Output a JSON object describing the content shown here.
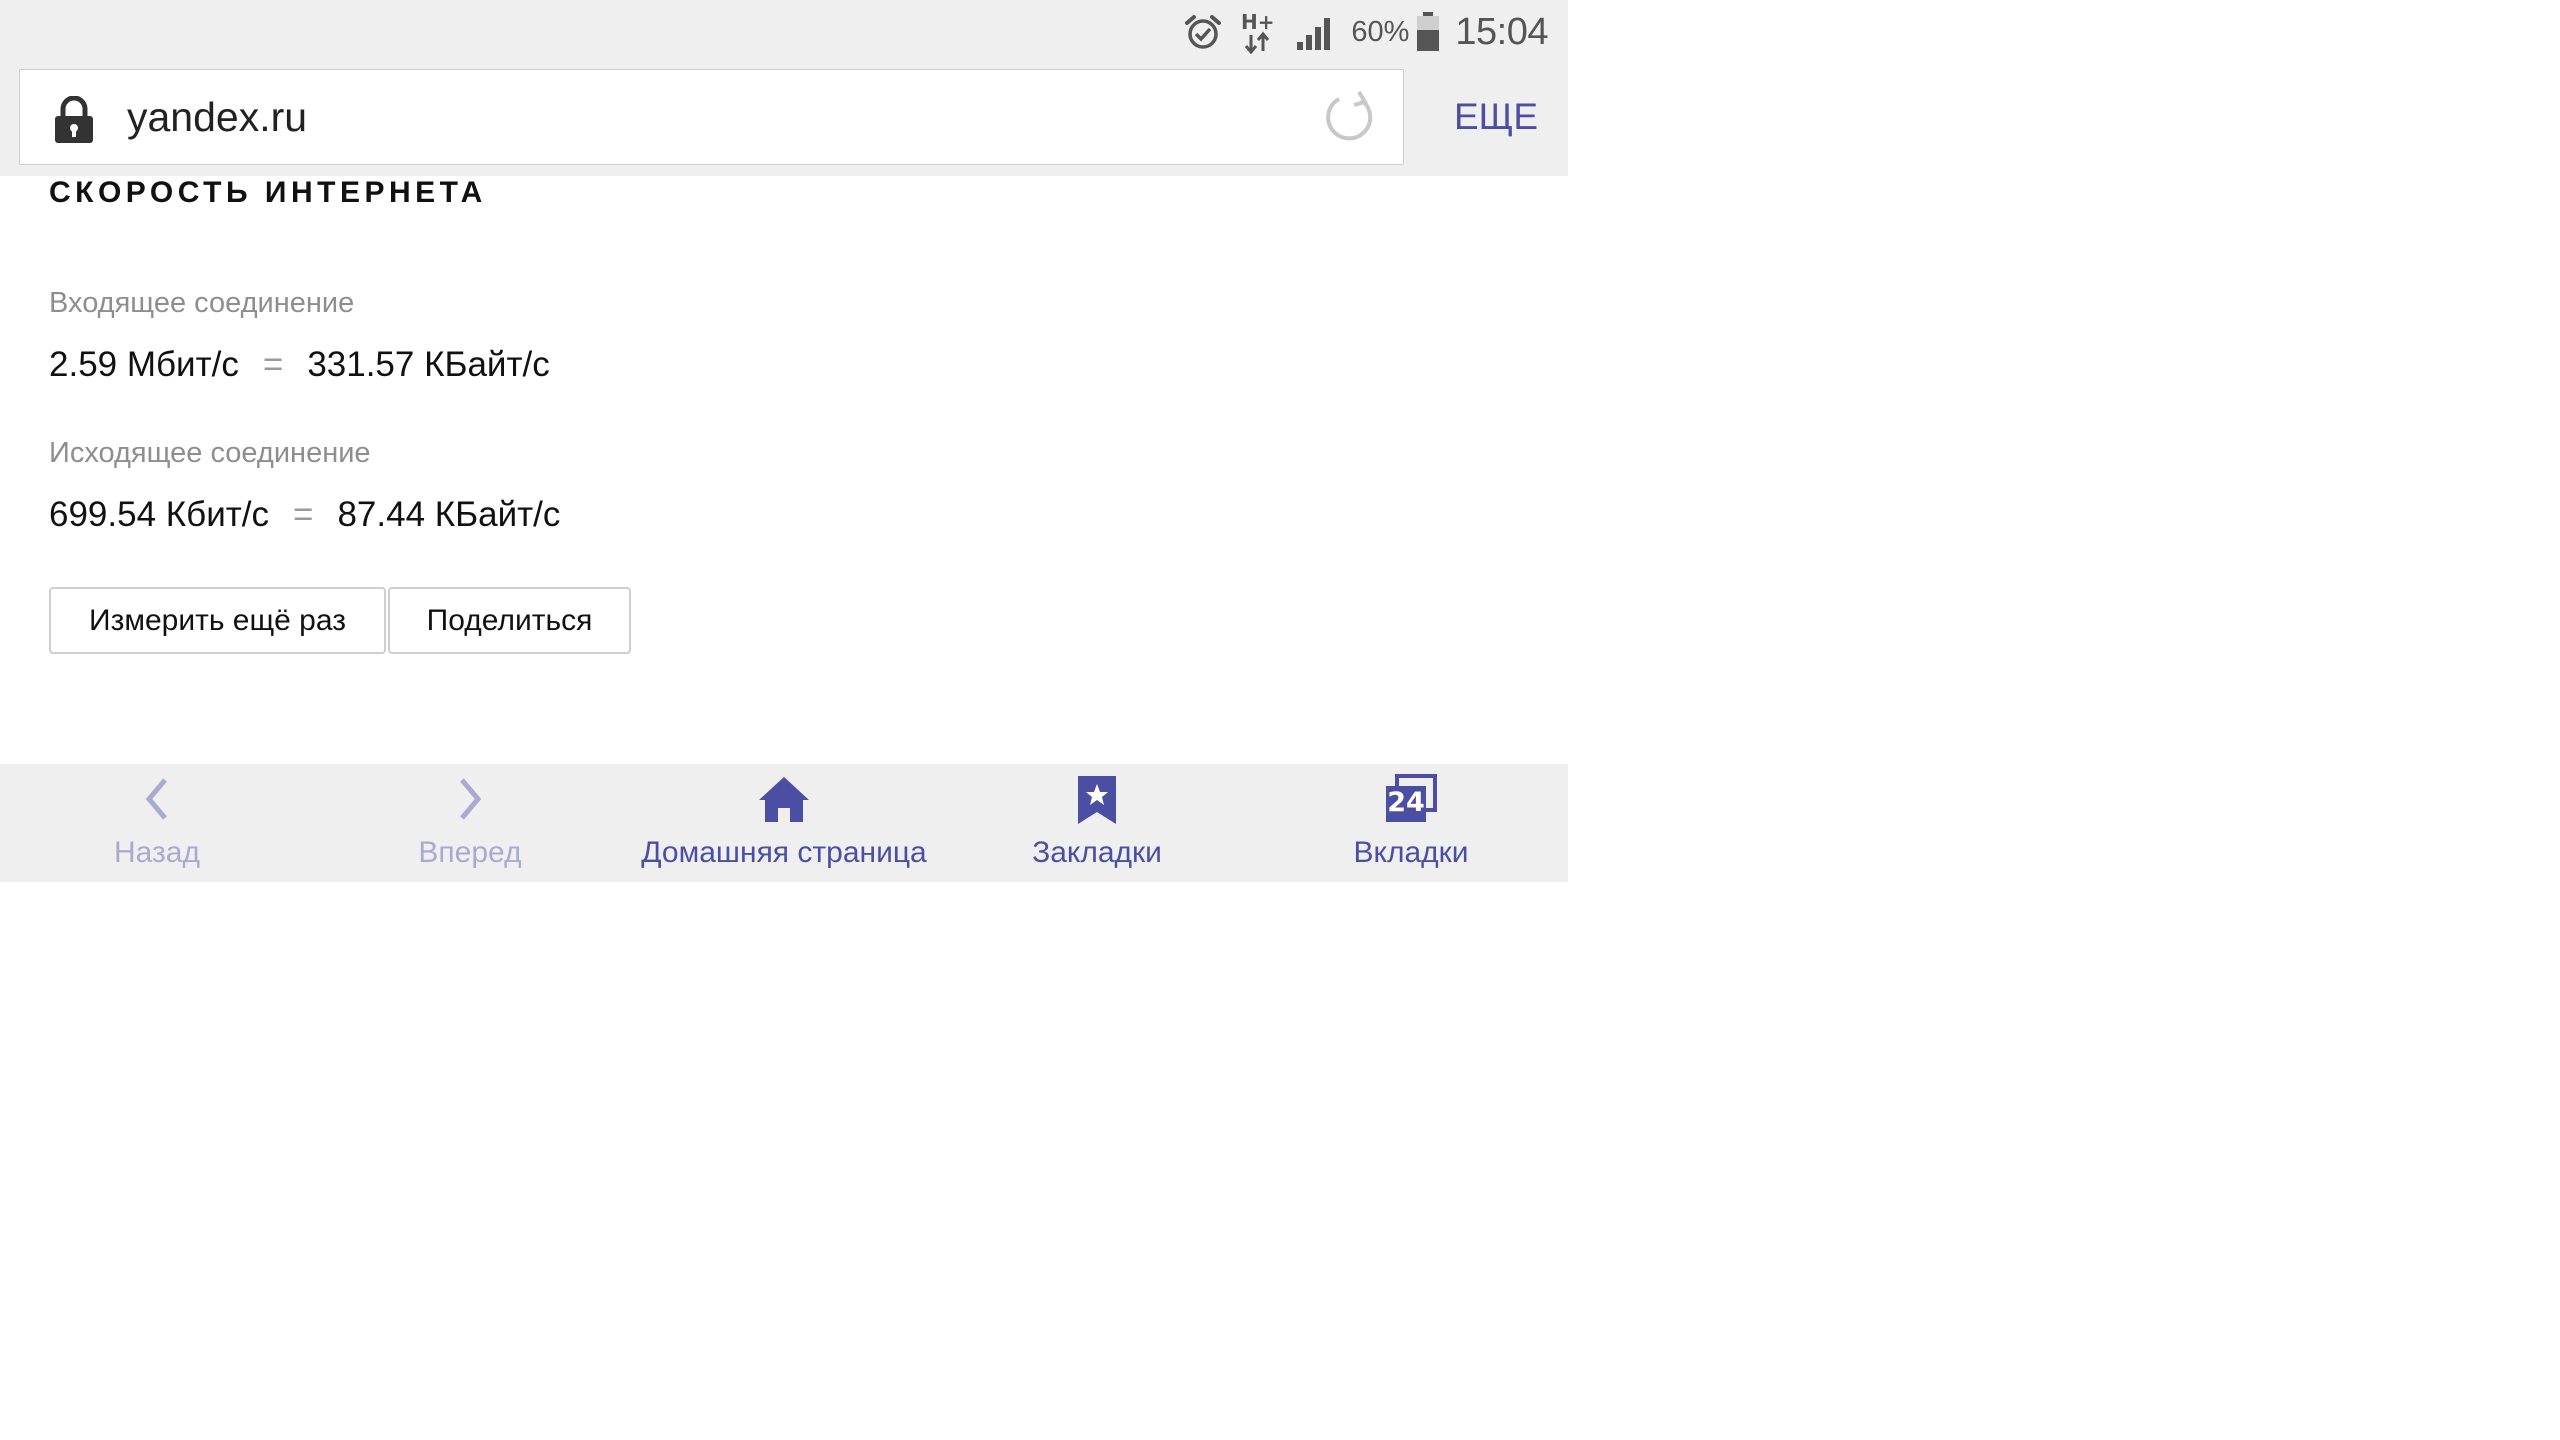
{
  "status_bar": {
    "network_type": "H+",
    "battery_percent": "60%",
    "time": "15:04",
    "icons": [
      "alarm-icon",
      "network-hplus-icon",
      "signal-icon",
      "battery-icon"
    ]
  },
  "browser": {
    "url": "yandex.ru",
    "more_label": "ЕЩЕ"
  },
  "page": {
    "title": "СКОРОСТЬ ИНТЕРНЕТА",
    "incoming": {
      "label": "Входящее соединение",
      "bits": "2.59 Мбит/с",
      "equals": "=",
      "bytes": "331.57 КБайт/с"
    },
    "outgoing": {
      "label": "Исходящее соединение",
      "bits": "699.54 Кбит/с",
      "equals": "=",
      "bytes": "87.44 КБайт/с"
    },
    "buttons": {
      "measure_again": "Измерить ещё раз",
      "share": "Поделиться"
    }
  },
  "bottom_nav": {
    "back": "Назад",
    "forward": "Вперед",
    "home": "Домашняя страница",
    "bookmarks": "Закладки",
    "tabs": "Вкладки",
    "tab_count": "24"
  },
  "colors": {
    "accent": "#4b4fa3",
    "disabled": "#a9aad2",
    "chrome_bg": "#efefef",
    "secondary_text": "#8e8e8e"
  }
}
